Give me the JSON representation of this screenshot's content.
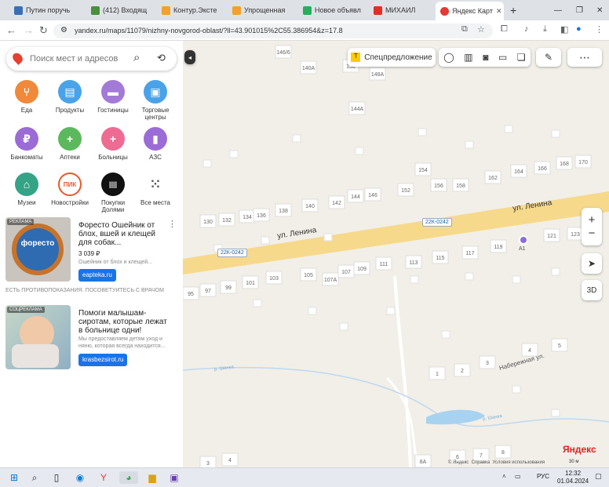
{
  "tabs": [
    {
      "label": "Путин поручь",
      "color": "#3a6fb6"
    },
    {
      "label": "(412) Входящ",
      "color": "#4a8f3c"
    },
    {
      "label": "Контур.Экстe",
      "color": "#f2a22b"
    },
    {
      "label": "Упрощенная",
      "color": "#f2a22b"
    },
    {
      "label": "Новое объявл",
      "color": "#27b05b"
    },
    {
      "label": "МИХАИЛ",
      "color": "#e52d27"
    },
    {
      "label": "Яндекс Карт",
      "color": "#e53935"
    }
  ],
  "address": {
    "url": "yandex.ru/maps/11079/nizhny-novgorod-oblast/?ll=43.901015%2C55.386954&z=17.8"
  },
  "search": {
    "placeholder": "Поиск мест и адресов"
  },
  "categories": [
    {
      "label": "Еда",
      "color": "#f08a3a",
      "glyph": "♨"
    },
    {
      "label": "Продукты",
      "color": "#4aa3e8",
      "glyph": "▤"
    },
    {
      "label": "Гостиницы",
      "color": "#a37ad8",
      "glyph": "▬"
    },
    {
      "label": "Торговые центры",
      "color": "#4aa3e8",
      "glyph": "▣"
    },
    {
      "label": "Банкоматы",
      "color": "#9b6cd6",
      "glyph": "₽"
    },
    {
      "label": "Аптеки",
      "color": "#5cb85c",
      "glyph": "+"
    },
    {
      "label": "Больницы",
      "color": "#ee6c93",
      "glyph": "+"
    },
    {
      "label": "АЗС",
      "color": "#9b6cd6",
      "glyph": "▮"
    },
    {
      "label": "Музеи",
      "color": "#35a386",
      "glyph": "⌂"
    },
    {
      "label": "Новостройки",
      "color": "#e55a2a",
      "glyph": "ПИК"
    },
    {
      "label": "Покупки Долями",
      "color": "#111111",
      "glyph": "||||"
    },
    {
      "label": "Все места",
      "color": "#ffffff",
      "glyph": "∷"
    }
  ],
  "ads": [
    {
      "badge": "РЕКЛАМА",
      "title": "Форесто Ошейник от блох, вшей и клещей для собак...",
      "price": "3 039 ₽",
      "desc": "Ошейник от блох и клещей...",
      "button": "eapteka.ru",
      "image_text": "форесто",
      "warning": "ЕСТЬ ПРОТИВОПОКАЗАНИЯ. ПОСОВЕТУЙТЕСЬ С ВРАЧОМ"
    },
    {
      "badge": "СОЦРЕКЛАМА",
      "title": "Помоги малышам-сиротам, которые лежат в больнице одни!",
      "desc": "Мы предоставляем детям уход и няню, которая всегда находится...",
      "button": "krasbezsirot.ru"
    }
  ],
  "map": {
    "promo": "Спецпредложение",
    "streets": [
      "ул. Ленина",
      "ул. Ленина",
      "Набережная ул.",
      "р. Шанка",
      "р. Шанка"
    ],
    "road_badges": [
      "22К-0242",
      "22К-0242"
    ],
    "houses": [
      "146/6",
      "140А",
      "150",
      "148А",
      "144А",
      "154",
      "156",
      "158",
      "162",
      "164",
      "166",
      "168",
      "170",
      "130",
      "132",
      "134",
      "136",
      "138",
      "140",
      "142",
      "144",
      "146",
      "152",
      "113",
      "115",
      "117",
      "119",
      "121",
      "123",
      "95",
      "97",
      "99",
      "101",
      "103",
      "105",
      "107А",
      "107",
      "109",
      "111",
      "1",
      "2",
      "3",
      "4",
      "5",
      "8А",
      "6",
      "7",
      "8",
      "3",
      "4"
    ],
    "marker": "А1",
    "btn_3d": "3D",
    "logo": "Яндекс",
    "scale": "30 м",
    "footer": [
      "© Яндекс",
      "Справка",
      "Условия использования"
    ]
  },
  "taskbar": {
    "lang": "РУС",
    "time": "12:32",
    "date": "01.04.2024"
  }
}
